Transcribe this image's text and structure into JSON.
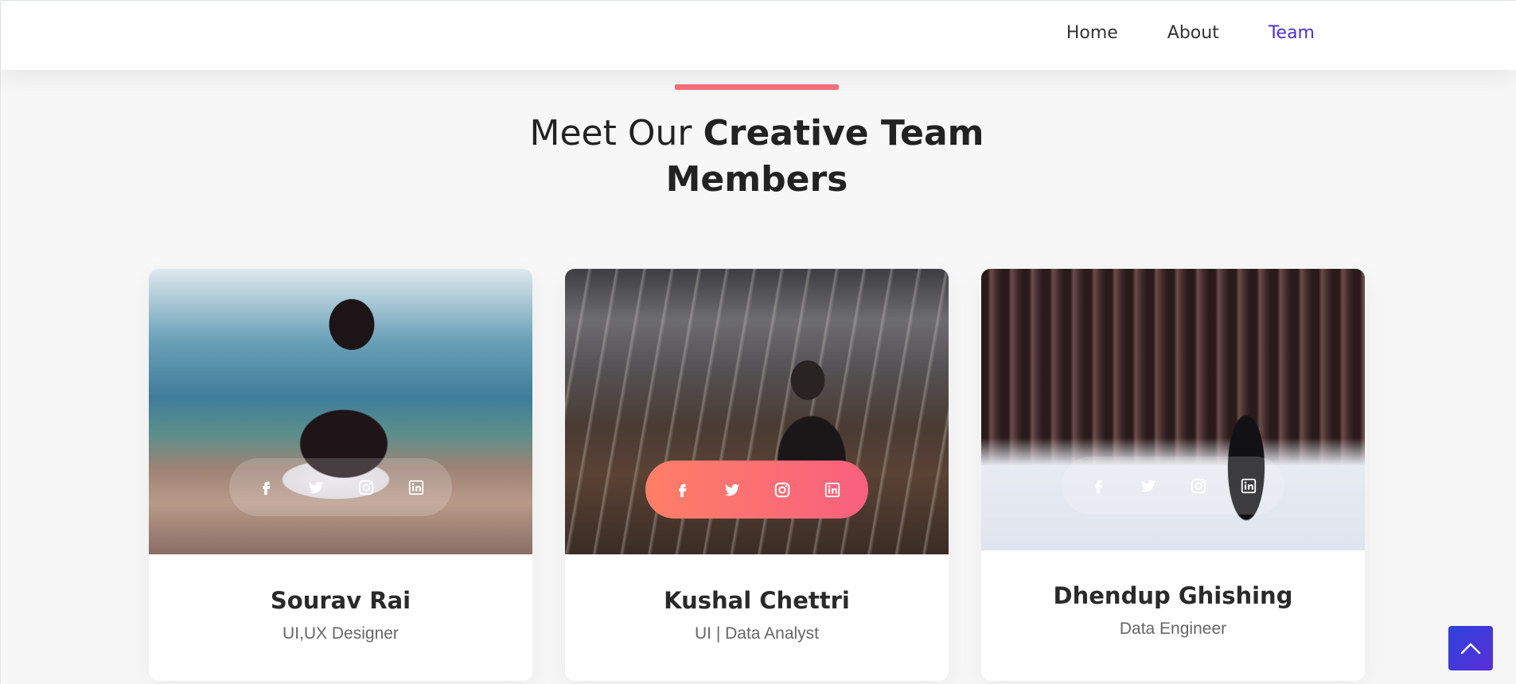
{
  "nav": {
    "items": [
      {
        "label": "Home"
      },
      {
        "label": "About"
      },
      {
        "label": "Team",
        "active": true
      }
    ],
    "active_color": "#4b2fd0"
  },
  "section": {
    "title_light": "Meet Our ",
    "title_bold_1": "Creative Team",
    "title_bold_2": "Members",
    "accent_color": "#f2707b"
  },
  "team": [
    {
      "name": "Sourav Rai",
      "role": "UI,UX Designer",
      "socials": [
        "facebook-icon",
        "twitter-icon",
        "instagram-icon",
        "linkedin-icon"
      ]
    },
    {
      "name": "Kushal Chettri",
      "role": "UI | Data Analyst",
      "socials": [
        "facebook-icon",
        "twitter-icon",
        "instagram-icon",
        "linkedin-icon"
      ],
      "highlighted": true
    },
    {
      "name": "Dhendup Ghishing",
      "role": "Data Engineer",
      "socials": [
        "facebook-icon",
        "twitter-icon",
        "instagram-icon",
        "linkedin-icon"
      ]
    }
  ],
  "back_to_top": {
    "icon": "chevron-up-icon",
    "color": "#3a3ad8"
  }
}
